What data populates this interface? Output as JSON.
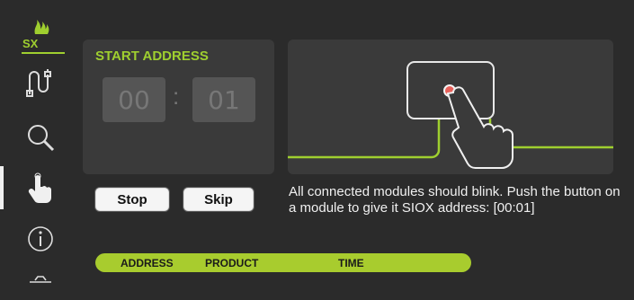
{
  "sidebar": {
    "logo_text": "SX",
    "items": [
      {
        "name": "connect-icon"
      },
      {
        "name": "search-icon"
      },
      {
        "name": "hand-pointer-icon"
      },
      {
        "name": "info-icon"
      },
      {
        "name": "gear-icon"
      }
    ]
  },
  "start_address": {
    "title": "START ADDRESS",
    "high": "00",
    "separator": ":",
    "low": "01"
  },
  "buttons": {
    "stop": "Stop",
    "skip": "Skip"
  },
  "message": "All connected modules should blink. Push the button on a module to give it SIOX address: [00:01]",
  "table": {
    "headers": [
      "ADDRESS",
      "PRODUCT",
      "TIME"
    ]
  },
  "colors": {
    "accent": "#9fcf2f",
    "background": "#2b2b2b",
    "panel": "#3a3a3a",
    "indicator": "#e8605a"
  }
}
